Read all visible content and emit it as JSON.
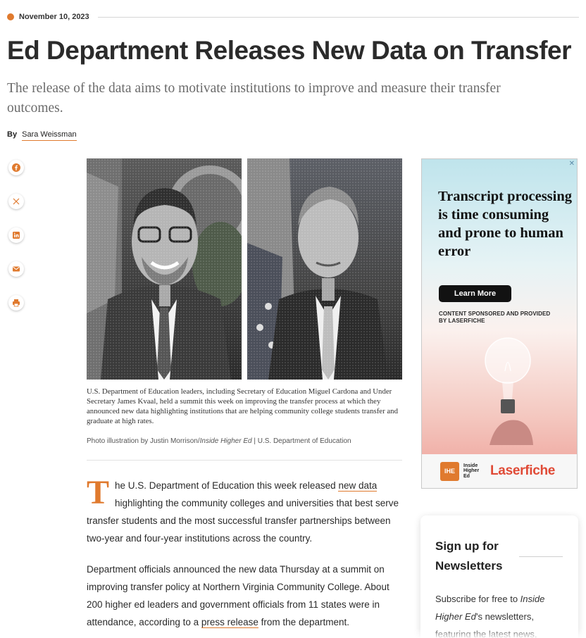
{
  "article": {
    "date": "November 10, 2023",
    "title": "Ed Department Releases New Data on Transfer",
    "subtitle": "The release of the data aims to motivate institutions to improve and measure their transfer outcomes.",
    "byline_prefix": "By",
    "author": "Sara Weissman",
    "caption": "U.S. Department of Education leaders, including Secretary of Education Miguel Cardona and Under Secretary James Kvaal, held a summit this week on improving the transfer process at which they announced new data highlighting institutions that are helping community college students transfer and graduate at high rates.",
    "credit_prefix": "Photo illustration by Justin Morrison/",
    "credit_pub": "Inside Higher Ed",
    "credit_suffix": " | U.S. Department of Education",
    "para1": {
      "dropcap": "T",
      "before_link": "he U.S. Department of Education this week released ",
      "link": "new data",
      "after_link": " highlighting the community colleges and universities that best serve transfer students and the most successful transfer partnerships between two-year and four-year institutions across the country."
    },
    "para2": {
      "before_link": "Department officials announced the new data Thursday at a summit on improving transfer policy at Northern Virginia Community College. About 200 higher ed leaders and government officials from 11 states were in attendance, according to a ",
      "link": "press release",
      "after_link": " from the department."
    }
  },
  "share_icons": [
    "facebook-icon",
    "x-icon",
    "linkedin-icon",
    "email-icon",
    "print-icon"
  ],
  "ad": {
    "close": "✕",
    "headline": "Transcript processing is time consuming and prone to human error",
    "cta": "Learn More",
    "sponsor": "CONTENT SPONSORED AND PROVIDED BY LASERFICHE",
    "ihe_badge": "IHE",
    "ihe_words": "Inside Higher Ed",
    "brand": "Laserfiche"
  },
  "newsletter": {
    "title": "Sign up for Newsletters",
    "text_before": "Subscribe for free to ",
    "text_pub": "Inside Higher Ed",
    "text_after": "’s newsletters, featuring the latest news,"
  },
  "colors": {
    "accent": "#e07a2e",
    "laserfiche": "#e04a36"
  }
}
